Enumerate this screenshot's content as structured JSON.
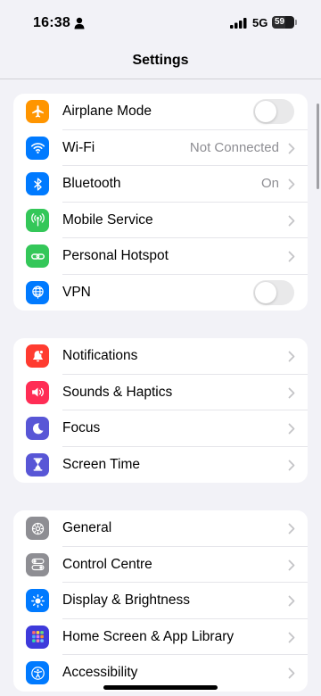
{
  "status_bar": {
    "time": "16:38",
    "network": "5G",
    "battery": "59",
    "battery_level": 0.59
  },
  "header": {
    "title": "Settings"
  },
  "groups": [
    {
      "items": [
        {
          "label": "Airplane Mode",
          "icon": "airplane-icon",
          "color": "#ff9500",
          "accessory": "toggle",
          "on": false
        },
        {
          "label": "Wi-Fi",
          "icon": "wifi-icon",
          "color": "#007aff",
          "value": "Not Connected",
          "accessory": "chevron"
        },
        {
          "label": "Bluetooth",
          "icon": "bluetooth-icon",
          "color": "#007aff",
          "value": "On",
          "accessory": "chevron"
        },
        {
          "label": "Mobile Service",
          "icon": "antenna-icon",
          "color": "#34c759",
          "accessory": "chevron"
        },
        {
          "label": "Personal Hotspot",
          "icon": "link-icon",
          "color": "#34c759",
          "accessory": "chevron"
        },
        {
          "label": "VPN",
          "icon": "globe-icon",
          "color": "#007aff",
          "accessory": "toggle",
          "on": false
        }
      ]
    },
    {
      "items": [
        {
          "label": "Notifications",
          "icon": "bell-icon",
          "color": "#ff3b30",
          "accessory": "chevron"
        },
        {
          "label": "Sounds & Haptics",
          "icon": "speaker-icon",
          "color": "#ff2d55",
          "accessory": "chevron"
        },
        {
          "label": "Focus",
          "icon": "moon-icon",
          "color": "#5856d6",
          "accessory": "chevron"
        },
        {
          "label": "Screen Time",
          "icon": "hourglass-icon",
          "color": "#5856d6",
          "accessory": "chevron"
        }
      ]
    },
    {
      "items": [
        {
          "label": "General",
          "icon": "gear-icon",
          "color": "#8e8e93",
          "accessory": "chevron"
        },
        {
          "label": "Control Centre",
          "icon": "switches-icon",
          "color": "#8e8e93",
          "accessory": "chevron"
        },
        {
          "label": "Display & Brightness",
          "icon": "sun-icon",
          "color": "#007aff",
          "accessory": "chevron"
        },
        {
          "label": "Home Screen & App Library",
          "icon": "app-grid-icon",
          "color": "#3e3adb",
          "accessory": "chevron"
        },
        {
          "label": "Accessibility",
          "icon": "accessibility-icon",
          "color": "#007aff",
          "accessory": "chevron"
        }
      ]
    }
  ]
}
